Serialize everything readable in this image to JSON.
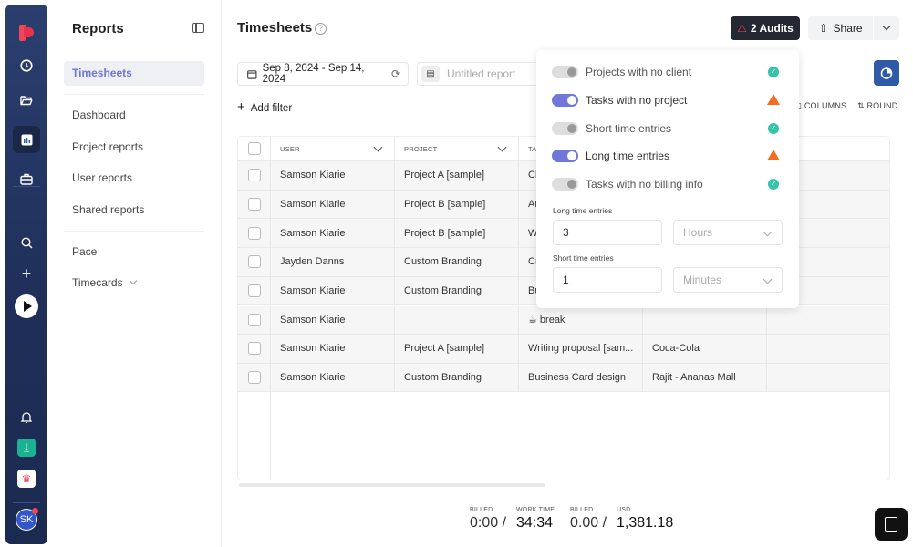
{
  "rail": {
    "icons": [
      "logo",
      "clock-icon",
      "folder-icon",
      "reports-icon",
      "briefcase-icon",
      "search-icon",
      "plus-icon",
      "play-icon",
      "bell-icon",
      "download-icon",
      "crown-icon"
    ],
    "avatar_initials": "SK"
  },
  "subnav": {
    "title": "Reports",
    "items": [
      {
        "label": "Timesheets",
        "active": true
      },
      {
        "label": "Dashboard"
      },
      {
        "label": "Project reports"
      },
      {
        "label": "User reports"
      },
      {
        "label": "Shared reports"
      },
      {
        "label": "Pace"
      },
      {
        "label": "Timecards"
      }
    ]
  },
  "header": {
    "title": "Timesheets",
    "help": "?",
    "audits_label": "2 Audits",
    "share_label": "Share"
  },
  "toolbar": {
    "date_range": "Sep 8, 2024 - Sep 14, 2024",
    "report_name_placeholder": "Untitled report",
    "add_filter": "Add filter",
    "columns_label": "COLUMNS",
    "round_label": "ROUND"
  },
  "table": {
    "columns": [
      "USER",
      "PROJECT",
      "TA"
    ],
    "rows": [
      {
        "user": "Samson Kiarie",
        "project": "Project A [sample]",
        "task": "Cl",
        "client": ""
      },
      {
        "user": "Samson Kiarie",
        "project": "Project B [sample]",
        "task": "Ar",
        "client": ""
      },
      {
        "user": "Samson Kiarie",
        "project": "Project B [sample]",
        "task": "W",
        "client": ""
      },
      {
        "user": "Jayden Danns",
        "project": "Custom Branding",
        "task": "Cr",
        "client": ""
      },
      {
        "user": "Samson Kiarie",
        "project": "Custom Branding",
        "task": "Bu",
        "client": ""
      },
      {
        "user": "Samson Kiarie",
        "project": "",
        "task": "☕ break",
        "client": ""
      },
      {
        "user": "Samson Kiarie",
        "project": "Project A [sample]",
        "task": "Writing proposal [sam...",
        "client": "Coca-Cola"
      },
      {
        "user": "Samson Kiarie",
        "project": "Custom Branding",
        "task": "Business Card design",
        "client": "Rajit - Ananas Mall"
      }
    ]
  },
  "totals": {
    "billed_time_label": "BILLED",
    "billed_time": "0:00 /",
    "work_time_label": "WORK TIME",
    "work_time": "34:34",
    "billed_amount_label": "BILLED",
    "billed_amount": "0.00 /",
    "currency_label": "USD",
    "total_amount": "1,381.18"
  },
  "audits_popover": {
    "items": [
      {
        "label": "Projects with no client",
        "enabled": false,
        "status": "ok"
      },
      {
        "label": "Tasks with no project",
        "enabled": true,
        "status": "warning"
      },
      {
        "label": "Short time entries",
        "enabled": false,
        "status": "ok"
      },
      {
        "label": "Long time entries",
        "enabled": true,
        "status": "warning"
      },
      {
        "label": "Tasks with no billing info",
        "enabled": false,
        "status": "ok"
      }
    ],
    "long_label": "Long time entries",
    "long_value": "3",
    "long_unit": "Hours",
    "short_label": "Short time entries",
    "short_value": "1",
    "short_unit": "Minutes"
  },
  "colors": {
    "accent": "#6f74d8",
    "warning": "#f07020",
    "ok": "#34c4a7",
    "rail": "#1f2f59"
  }
}
